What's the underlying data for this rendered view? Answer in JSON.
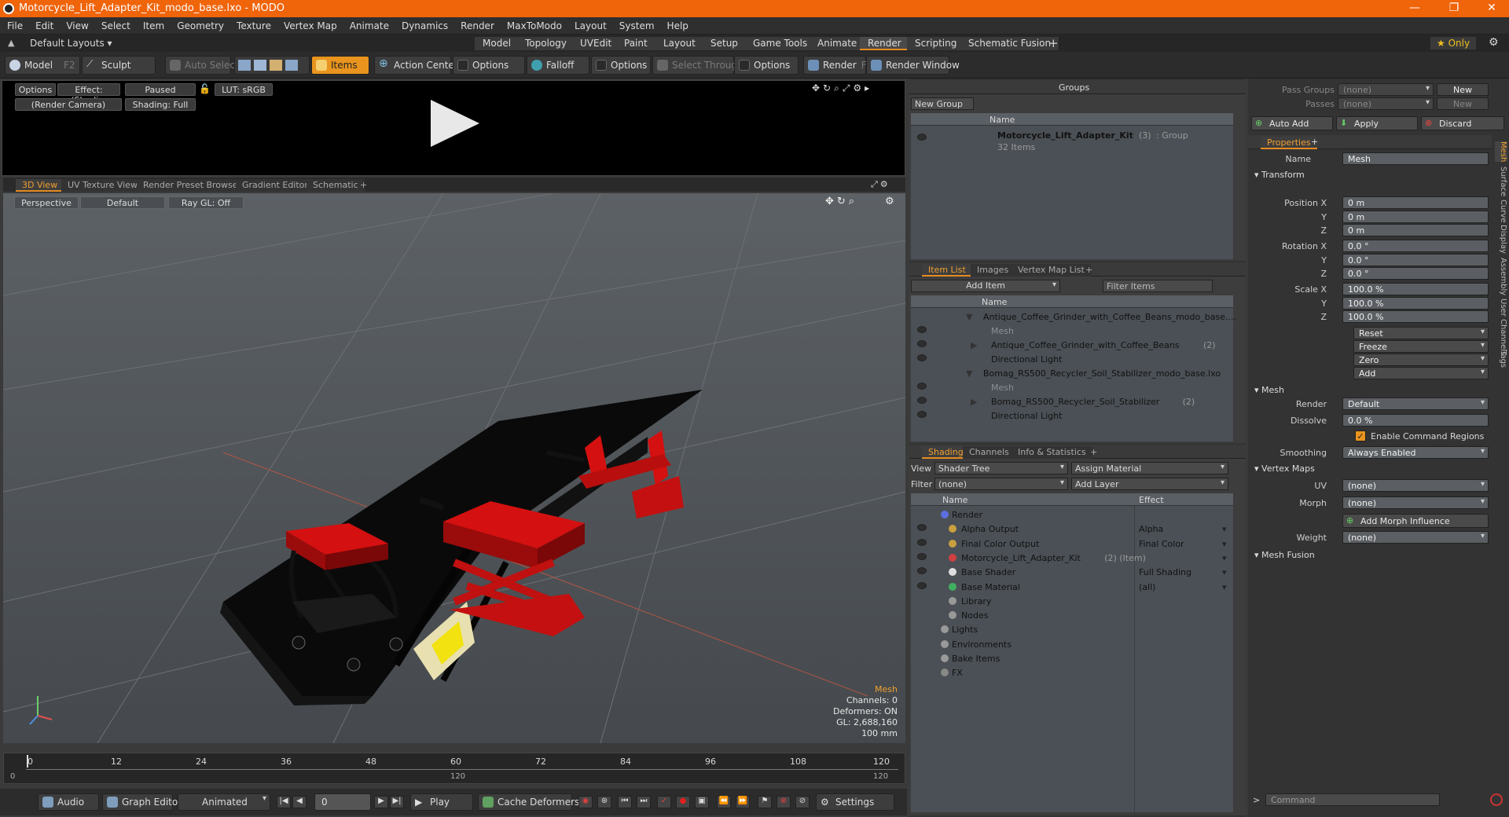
{
  "titlebar": {
    "title": "Motorcycle_Lift_Adapter_Kit_modo_base.lxo - MODO",
    "min": "—",
    "max": "❐",
    "close": "✕"
  },
  "menu": [
    "File",
    "Edit",
    "View",
    "Select",
    "Item",
    "Geometry",
    "Texture",
    "Vertex Map",
    "Animate",
    "Dynamics",
    "Render",
    "MaxToModo",
    "Layout",
    "System",
    "Help"
  ],
  "layouts": {
    "dropdown": "Default Layouts ▾",
    "tabs": [
      "Model",
      "Topology",
      "UVEdit",
      "Paint",
      "Layout",
      "Setup",
      "Game Tools",
      "Animate",
      "Render",
      "Scripting",
      "Schematic Fusion"
    ],
    "active": "Render",
    "add": "+",
    "only": "★ Only"
  },
  "toolbar": {
    "model": "Model",
    "model_key": "F2",
    "sculpt": "Sculpt",
    "auto_select": "Auto Select",
    "items": "Items",
    "action_center": "Action Center",
    "options1": "Options",
    "falloff": "Falloff",
    "options2": "Options",
    "select_through": "Select Through",
    "options3": "Options",
    "render": "Render",
    "render_key": "F9",
    "render_window": "Render Window"
  },
  "render": {
    "options": "Options",
    "effect": "Effect: (Shadi...",
    "paused": "Paused",
    "lut": "LUT: sRGB",
    "camera": "(Render Camera)",
    "shading": "Shading: Full"
  },
  "viewtabs": [
    "3D View",
    "UV Texture View",
    "Render Preset Browser",
    "Gradient Editor",
    "Schematic",
    "+"
  ],
  "viewport": {
    "perspective": "Perspective",
    "default": "Default",
    "raygl": "Ray GL: Off",
    "info": {
      "mesh": "Mesh",
      "channels": "Channels: 0",
      "deformers": "Deformers: ON",
      "gl": "GL: 2,688,160",
      "size": "100 mm"
    }
  },
  "timeline": {
    "ticks": [
      "0",
      "12",
      "24",
      "36",
      "48",
      "60",
      "72",
      "84",
      "96",
      "108",
      "120"
    ],
    "lower": [
      "0",
      "120",
      "120"
    ]
  },
  "bottom": {
    "audio": "Audio",
    "graph": "Graph Editor",
    "animated": "Animated",
    "frame": "0",
    "play": "Play",
    "cache": "Cache Deformers",
    "settings": "Settings"
  },
  "groups": {
    "title": "Groups",
    "new_group": "New Group",
    "col": "Name",
    "item": "Motorcycle_Lift_Adapter_Kit",
    "count": "(3)",
    "type": ": Group",
    "sub": "32 Items"
  },
  "itemlist": {
    "tabs": [
      "Item List",
      "Images",
      "Vertex Map List",
      "+"
    ],
    "add": "Add Item",
    "filter": "Filter Items",
    "col": "Name",
    "rows": [
      {
        "t": "Antique_Coffee_Grinder_with_Coffee_Beans_modo_base....",
        "ind": 0,
        "gray": false
      },
      {
        "t": "Mesh",
        "ind": 1,
        "gray": true
      },
      {
        "t": "Antique_Coffee_Grinder_with_Coffee_Beans",
        "c": "(2)",
        "ind": 1,
        "gray": false
      },
      {
        "t": "Directional Light",
        "ind": 1,
        "gray": false
      },
      {
        "t": "Bomag_RS500_Recycler_Soil_Stabilizer_modo_base.lxo",
        "ind": 0,
        "gray": false
      },
      {
        "t": "Mesh",
        "ind": 1,
        "gray": true
      },
      {
        "t": "Bomag_RS500_Recycler_Soil_Stabilizer",
        "c": "(2)",
        "ind": 1,
        "gray": false
      },
      {
        "t": "Directional Light",
        "ind": 1,
        "gray": false
      }
    ]
  },
  "shading": {
    "tabs": [
      "Shading",
      "Channels",
      "Info & Statistics",
      "+"
    ],
    "view_lbl": "View",
    "view": "Shader Tree",
    "assign": "Assign Material",
    "filter_lbl": "Filter",
    "filter": "(none)",
    "addlayer": "Add Layer",
    "col_name": "Name",
    "col_effect": "Effect",
    "rows": [
      {
        "n": "Render",
        "e": "",
        "ind": 0
      },
      {
        "n": "Alpha Output",
        "e": "Alpha",
        "ind": 1
      },
      {
        "n": "Final Color Output",
        "e": "Final Color",
        "ind": 1
      },
      {
        "n": "Motorcycle_Lift_Adapter_Kit",
        "c": "(2) (Item)",
        "e": "",
        "ind": 1
      },
      {
        "n": "Base Shader",
        "e": "Full Shading",
        "ind": 1
      },
      {
        "n": "Base Material",
        "e": "(all)",
        "ind": 1
      },
      {
        "n": "Library",
        "e": "",
        "ind": 1
      },
      {
        "n": "Nodes",
        "e": "",
        "ind": 1
      },
      {
        "n": "Lights",
        "e": "",
        "ind": 0
      },
      {
        "n": "Environments",
        "e": "",
        "ind": 0
      },
      {
        "n": "Bake Items",
        "e": "",
        "ind": 0
      },
      {
        "n": "FX",
        "e": "",
        "ind": 0
      }
    ]
  },
  "right": {
    "pass_groups": "Pass Groups",
    "passes": "Passes",
    "none": "(none)",
    "new": "New",
    "auto_add": "Auto Add",
    "apply": "Apply",
    "discard": "Discard",
    "properties": "Properties",
    "name_lbl": "Name",
    "name": "Mesh",
    "transform": "Transform",
    "pos_lbl": "Position X",
    "rot_lbl": "Rotation X",
    "scale_lbl": "Scale X",
    "y": "Y",
    "z": "Z",
    "pos": [
      "0 m",
      "0 m",
      "0 m"
    ],
    "rot": [
      "0.0 °",
      "0.0 °",
      "0.0 °"
    ],
    "scale": [
      "100.0 %",
      "100.0 %",
      "100.0 %"
    ],
    "reset": "Reset",
    "freeze": "Freeze",
    "zero": "Zero",
    "add": "Add",
    "mesh": "Mesh",
    "render_lbl": "Render",
    "render": "Default",
    "dissolve_lbl": "Dissolve",
    "dissolve": "0.0 %",
    "cmd_regions": "Enable Command Regions",
    "smoothing_lbl": "Smoothing",
    "smoothing": "Always Enabled",
    "vertex_maps": "Vertex Maps",
    "uv_lbl": "UV",
    "morph_lbl": "Morph",
    "add_morph": "Add Morph Influence",
    "weight_lbl": "Weight",
    "mesh_fusion": "Mesh Fusion",
    "command": "Command",
    "sidetabs": [
      "Mesh",
      "Surface",
      "Curve",
      "Display",
      "Assembly",
      "User Channels",
      "Tags"
    ]
  },
  "colors": {
    "accent": "#f0640a",
    "selected": "#e8941e",
    "red": "#e11616"
  }
}
